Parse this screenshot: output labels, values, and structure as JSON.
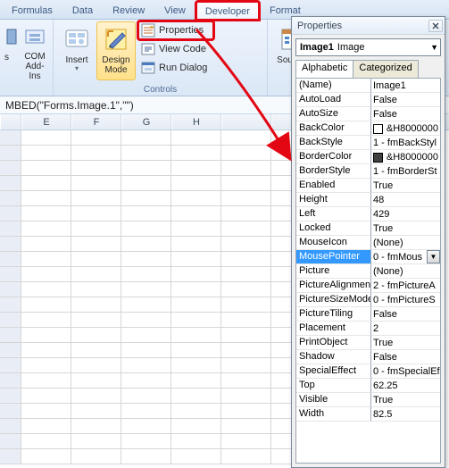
{
  "tabs": {
    "formulas": "Formulas",
    "data": "Data",
    "review": "Review",
    "view": "View",
    "developer": "Developer",
    "format": "Format"
  },
  "ribbon": {
    "addins_group_label": "",
    "addins_btn": "s",
    "com_addins": "COM\nAdd-Ins",
    "insert": "Insert",
    "design_mode": "Design\nMode",
    "properties": "Properties",
    "view_code": "View Code",
    "run_dialog": "Run Dialog",
    "controls_group": "Controls",
    "source": "Source"
  },
  "formula_bar": "MBED(\"Forms.Image.1\",\"\")",
  "columns": [
    "E",
    "F",
    "G",
    "H"
  ],
  "props_window": {
    "title": "Properties",
    "object_name": "Image1",
    "object_type": "Image",
    "tab_alpha": "Alphabetic",
    "tab_cat": "Categorized"
  },
  "properties": [
    {
      "n": "(Name)",
      "v": "Image1"
    },
    {
      "n": "AutoLoad",
      "v": "False"
    },
    {
      "n": "AutoSize",
      "v": "False"
    },
    {
      "n": "BackColor",
      "v": "&H8000000",
      "swatch": "#ffffff"
    },
    {
      "n": "BackStyle",
      "v": "1 - fmBackStyl"
    },
    {
      "n": "BorderColor",
      "v": "&H8000000",
      "swatch": "#404040"
    },
    {
      "n": "BorderStyle",
      "v": "1 - fmBorderSt"
    },
    {
      "n": "Enabled",
      "v": "True"
    },
    {
      "n": "Height",
      "v": "48"
    },
    {
      "n": "Left",
      "v": "429"
    },
    {
      "n": "Locked",
      "v": "True"
    },
    {
      "n": "MouseIcon",
      "v": "(None)"
    },
    {
      "n": "MousePointer",
      "v": "0 - fmMous",
      "sel": true,
      "dd": true
    },
    {
      "n": "Picture",
      "v": "(None)"
    },
    {
      "n": "PictureAlignment",
      "v": "2 - fmPictureA"
    },
    {
      "n": "PictureSizeMode",
      "v": "0 - fmPictureS"
    },
    {
      "n": "PictureTiling",
      "v": "False"
    },
    {
      "n": "Placement",
      "v": "2"
    },
    {
      "n": "PrintObject",
      "v": "True"
    },
    {
      "n": "Shadow",
      "v": "False"
    },
    {
      "n": "SpecialEffect",
      "v": "0 - fmSpecialEf"
    },
    {
      "n": "Top",
      "v": "62.25"
    },
    {
      "n": "Visible",
      "v": "True"
    },
    {
      "n": "Width",
      "v": "82.5"
    }
  ]
}
